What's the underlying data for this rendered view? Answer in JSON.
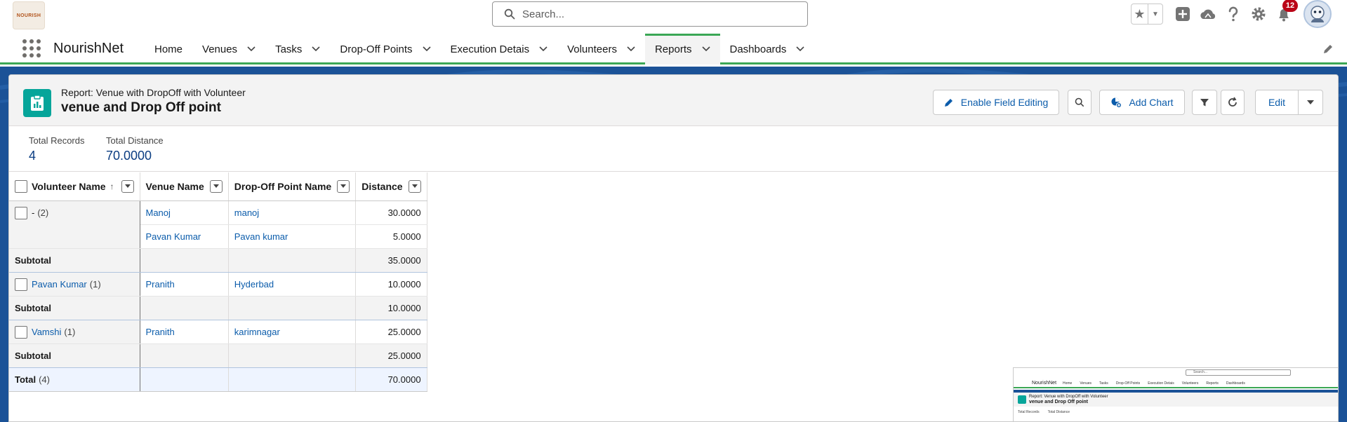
{
  "header": {
    "logo_text": "NOURISH",
    "search_placeholder": "Search...",
    "notification_count": "12"
  },
  "nav": {
    "app_name": "NourishNet",
    "items": [
      {
        "label": "Home",
        "has_menu": false
      },
      {
        "label": "Venues",
        "has_menu": true
      },
      {
        "label": "Tasks",
        "has_menu": true
      },
      {
        "label": "Drop-Off Points",
        "has_menu": true
      },
      {
        "label": "Execution Detais",
        "has_menu": true
      },
      {
        "label": "Volunteers",
        "has_menu": true
      },
      {
        "label": "Reports",
        "has_menu": true,
        "active": true
      },
      {
        "label": "Dashboards",
        "has_menu": true
      }
    ]
  },
  "report": {
    "type_label": "Report: Venue with DropOff with Volunteer",
    "title": "venue and Drop Off point",
    "buttons": {
      "enable_field_editing": "Enable Field Editing",
      "add_chart": "Add Chart",
      "edit": "Edit"
    },
    "summary": {
      "total_records_label": "Total Records",
      "total_records_value": "4",
      "total_distance_label": "Total Distance",
      "total_distance_value": "70.0000"
    },
    "columns": [
      "Volunteer Name",
      "Venue Name",
      "Drop-Off Point Name",
      "Distance"
    ],
    "groups": [
      {
        "name": "-",
        "count": "(2)",
        "is_link": false,
        "rows": [
          {
            "venue": "Manoj",
            "drop": "manoj",
            "distance": "30.0000"
          },
          {
            "venue": "Pavan Kumar",
            "drop": "Pavan kumar",
            "distance": "5.0000"
          }
        ],
        "subtotal_label": "Subtotal",
        "subtotal": "35.0000"
      },
      {
        "name": "Pavan Kumar",
        "count": "(1)",
        "is_link": true,
        "rows": [
          {
            "venue": "Pranith",
            "drop": "Hyderbad",
            "distance": "10.0000"
          }
        ],
        "subtotal_label": "Subtotal",
        "subtotal": "10.0000"
      },
      {
        "name": "Vamshi",
        "count": "(1)",
        "is_link": true,
        "rows": [
          {
            "venue": "Pranith",
            "drop": "karimnagar",
            "distance": "25.0000"
          }
        ],
        "subtotal_label": "Subtotal",
        "subtotal": "25.0000"
      }
    ],
    "total_label": "Total",
    "total_count": "(4)",
    "total_value": "70.0000"
  },
  "thumbnail": {
    "search": "Search...",
    "app_name": "NourishNet",
    "nav_items": [
      "Home",
      "Venues",
      "Tasks",
      "Drop-Off Points",
      "Execution Detais",
      "Volunteers",
      "Reports",
      "Dashboards"
    ],
    "type_label": "Report: Venue with DropOff with Volunteer",
    "title": "venue and Drop Off point",
    "sum1": "Total Records",
    "sum2": "Total Distance"
  },
  "colors": {
    "brand_blue": "#1b5297",
    "accent_green": "#3ba755",
    "link": "#0b5cab",
    "report_icon": "#06a59a",
    "badge_red": "#ba0517"
  }
}
